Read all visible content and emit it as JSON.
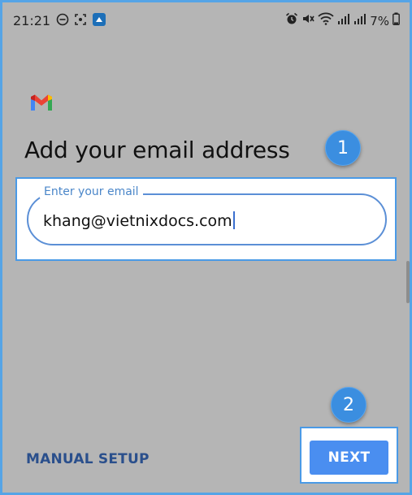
{
  "status_bar": {
    "time": "21:21",
    "battery": "7%",
    "left_icons": [
      "dnd-icon",
      "screenshot-icon",
      "app-icon"
    ],
    "right_icons": [
      "alarm-icon",
      "mute-icon",
      "wifi-icon",
      "signal-icon",
      "signal-icon",
      "battery-icon"
    ]
  },
  "page": {
    "title": "Add your email address"
  },
  "email": {
    "label": "Enter your email",
    "value": "khang@vietnixdocs.com"
  },
  "actions": {
    "manual_setup": "MANUAL SETUP",
    "next": "NEXT"
  },
  "steps": {
    "one": "1",
    "two": "2"
  },
  "colors": {
    "highlight": "#4a9ae6",
    "badge": "#3b8ee0",
    "next_button": "#4a8ef0",
    "manual_setup_text": "#2a4f8c",
    "overlay_background": "#b5b5b5"
  }
}
